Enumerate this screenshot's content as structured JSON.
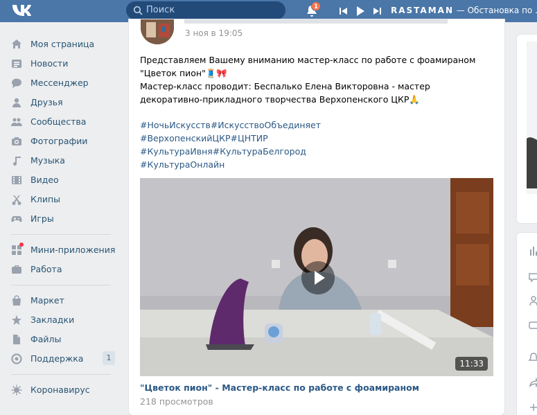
{
  "header": {
    "search_placeholder": "Поиск",
    "notifications_count": "1",
    "now_playing_artist": "RASTAMAN",
    "now_playing_title": " — Обстановка по ..."
  },
  "sidebar": {
    "items": [
      {
        "label": "Моя страница",
        "icon": "home-icon"
      },
      {
        "label": "Новости",
        "icon": "news-icon"
      },
      {
        "label": "Мессенджер",
        "icon": "messenger-icon"
      },
      {
        "label": "Друзья",
        "icon": "friends-icon"
      },
      {
        "label": "Сообщества",
        "icon": "communities-icon"
      },
      {
        "label": "Фотографии",
        "icon": "camera-icon"
      },
      {
        "label": "Музыка",
        "icon": "music-icon"
      },
      {
        "label": "Видео",
        "icon": "video-icon"
      },
      {
        "label": "Клипы",
        "icon": "clips-icon"
      },
      {
        "label": "Игры",
        "icon": "gamepad-icon"
      }
    ],
    "items2": [
      {
        "label": "Мини-приложения",
        "icon": "mini-apps-icon"
      },
      {
        "label": "Работа",
        "icon": "briefcase-icon"
      }
    ],
    "items3": [
      {
        "label": "Маркет",
        "icon": "market-icon"
      },
      {
        "label": "Закладки",
        "icon": "star-icon"
      },
      {
        "label": "Файлы",
        "icon": "file-icon"
      },
      {
        "label": "Поддержка",
        "icon": "support-icon",
        "count": "1"
      }
    ],
    "items4": [
      {
        "label": "Коронавирус",
        "icon": "virus-icon"
      }
    ]
  },
  "post": {
    "date": "3 ноя в 19:05",
    "text_line1": "Представляем Вашему вниманию мастер-класс по работе с фоамираном \"Цветок пион\"🧵🎀",
    "text_line2": "Мастер-класс проводит: Беспалько Елена Викторовна - мастер декоративно-прикладного творчества Верхопенского ЦКР🙏",
    "hashtags": [
      "#НочьИскусств#ИскусствоОбъединяет",
      "#ВерхопенскийЦКР#ЦНТИР",
      "#КультураИвня#КультураБелгород",
      "#КультураОнлайн"
    ],
    "video_duration": "11:33",
    "video_title": "\"Цветок пион\" - Мастер-класс по работе с фоамираном",
    "video_views": "218 просмотров"
  },
  "colors": {
    "header": "#4a76a8",
    "link": "#2a5885",
    "nav_text": "#285473",
    "background": "#edeef0"
  }
}
